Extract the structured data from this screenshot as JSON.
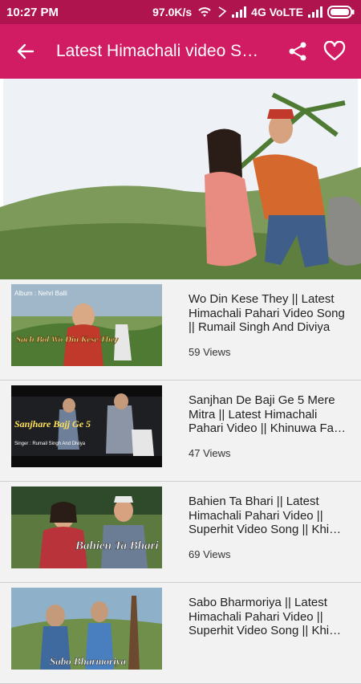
{
  "status": {
    "time": "10:27 PM",
    "speed": "97.0K/s",
    "network": "4G VoLTE"
  },
  "appbar": {
    "title": "Latest Himachali video S…",
    "back_icon": "arrow-left-icon",
    "share_icon": "share-icon",
    "favorite_icon": "heart-outline-icon"
  },
  "videos": [
    {
      "title": "Wo Din Kese They || Latest Himachali Pahari Video Song || Rumail Singh And Diviya",
      "views": "59 Views",
      "thumb_caption": "Sach Bol Wo Din Kese They",
      "thumb_album": "Album : Nehri Balli"
    },
    {
      "title": "Sanjhan De Baji Ge 5 Mere Mitra || Latest Himachali Pahari Video || Khinuwa Fa…",
      "views": "47 Views",
      "thumb_caption": "Sanjhare Bajj Ge 5",
      "thumb_sub": "Singer : Rumail Singh And Diviya"
    },
    {
      "title": "Bahien Ta Bhari || Latest Himachali Pahari Video || Superhit Video Song || Khi…",
      "views": "69 Views",
      "thumb_caption": "Bahien Ta Bhari"
    },
    {
      "title": "Sabo Bharmoriya || Latest Himachali Pahari Video || Superhit Video Song || Khi…",
      "views": "",
      "thumb_caption": "Sabo Bharmoriya"
    }
  ]
}
